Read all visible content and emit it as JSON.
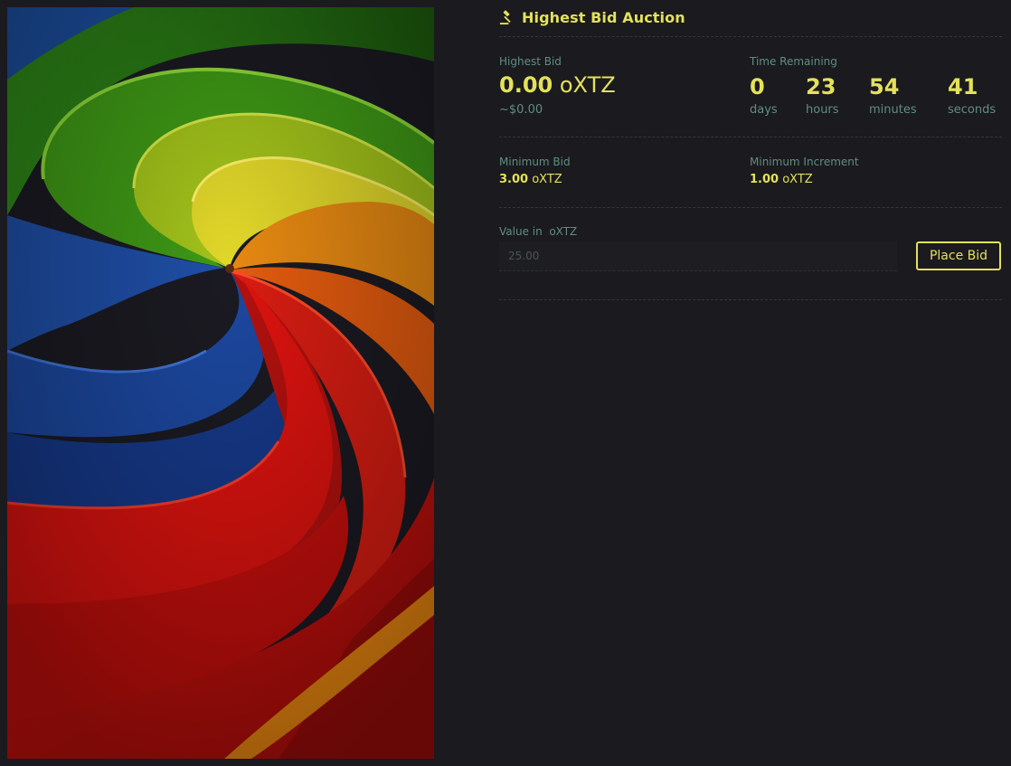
{
  "artwork": {
    "icon": "artwork-image"
  },
  "auction": {
    "icon": "gavel-icon",
    "title": "Highest Bid Auction",
    "highest_bid": {
      "label": "Highest Bid",
      "amount": "0.00",
      "currency": "oXTZ",
      "usd": "~$0.00"
    },
    "time_remaining": {
      "label": "Time Remaining",
      "days": "0",
      "days_label": "days",
      "hours": "23",
      "hours_label": "hours",
      "minutes": "54",
      "minutes_label": "minutes",
      "seconds": "41",
      "seconds_label": "seconds"
    },
    "minimum_bid": {
      "label": "Minimum Bid",
      "amount": "3.00",
      "currency": "oXTZ"
    },
    "minimum_increment": {
      "label": "Minimum Increment",
      "amount": "1.00",
      "currency": "oXTZ"
    },
    "bid_input": {
      "label": "Value in  oXTZ",
      "placeholder": "25.00",
      "value": ""
    },
    "place_bid_label": "Place Bid"
  },
  "colors": {
    "background": "#1b1a1f",
    "accent": "#e3e15a",
    "muted": "#5f8f7e"
  }
}
